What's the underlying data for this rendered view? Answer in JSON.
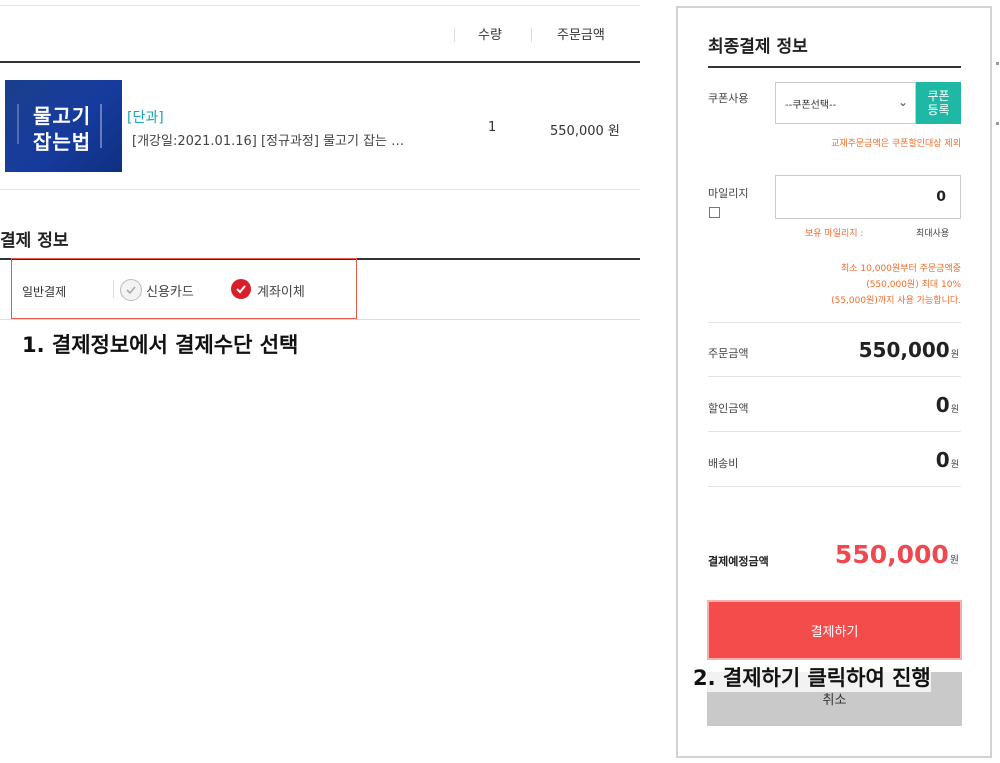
{
  "order_table": {
    "headers": {
      "quantity": "수량",
      "order_amount": "주문금액"
    },
    "item": {
      "thumbnail_text_line1": "물고기",
      "thumbnail_text_line2": "잡는법",
      "category_tag": "[단과]",
      "name": "[개강일:2021.01.16] [정규과정] 물고기 잡는 …",
      "quantity": "1",
      "price": "550,000 원"
    }
  },
  "payment_info": {
    "title": "결제 정보",
    "type_label": "일반결제",
    "options": [
      {
        "label": "신용카드",
        "selected": false
      },
      {
        "label": "계좌이체",
        "selected": true
      }
    ],
    "highlight_color": "#e8584b",
    "caption": "1. 결제정보에서 결제수단 선택"
  },
  "final_panel": {
    "title": "최종결제 정보",
    "coupon": {
      "label": "쿠폰사용",
      "select_value": "--쿠폰선택--",
      "button_label": "쿠폰\n등록",
      "note": "교재주문금액은 쿠폰할인대상 제외"
    },
    "mileage": {
      "label": "마일리지",
      "value": "0",
      "holding_label": "보유 마일리지 :",
      "max_label": "최대사용",
      "note_line1": "최소 10,000원부터 주문금액중",
      "note_line2": "(550,000원) 최대 10%",
      "note_line3": "(55,000원)까지 사용 가능합니다."
    },
    "summary": [
      {
        "label": "주문금액",
        "value": "550,000",
        "unit": "원"
      },
      {
        "label": "할인금액",
        "value": "0",
        "unit": "원"
      },
      {
        "label": "배송비",
        "value": "0",
        "unit": "원"
      }
    ],
    "final": {
      "label": "결제예정금액",
      "value": "550,000",
      "unit": "원"
    },
    "pay_button": "결제하기",
    "cancel_button": "취소",
    "caption": "2. 결제하기 클릭하여 진행",
    "colors": {
      "accent": "#f44b4b",
      "teal": "#1fb8a5",
      "note": "#f26b2a"
    }
  }
}
